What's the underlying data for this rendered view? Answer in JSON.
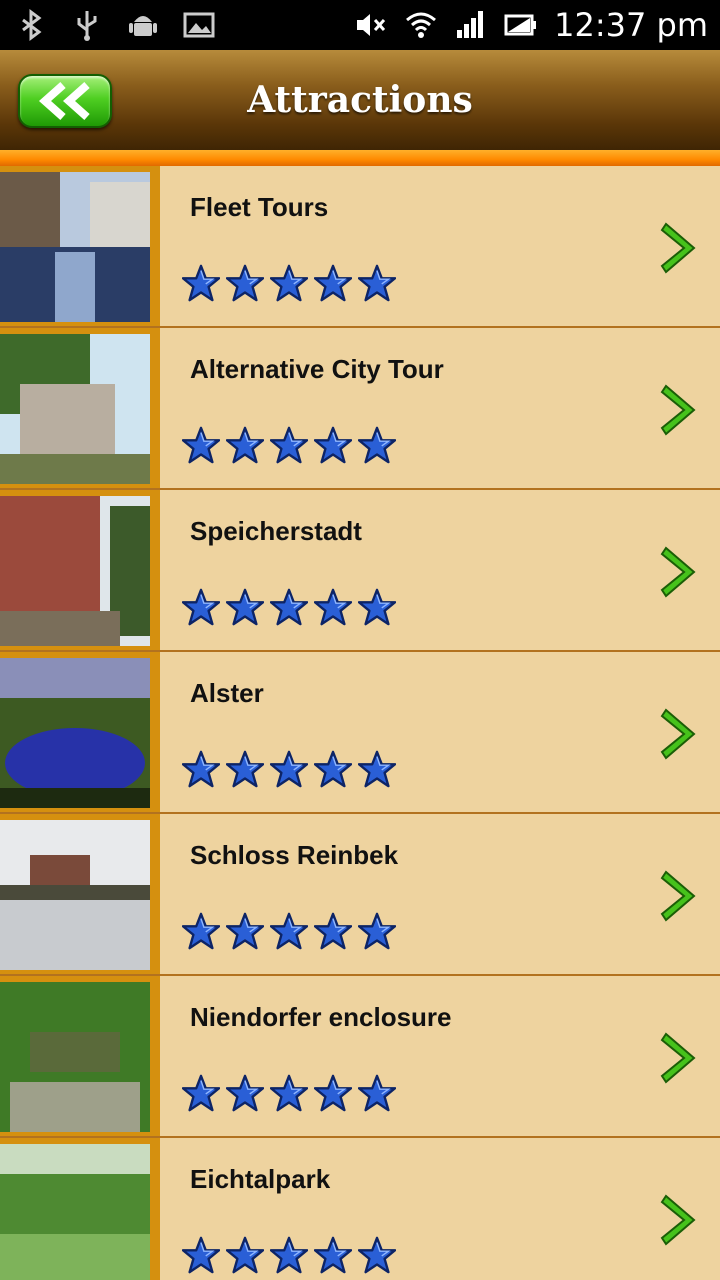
{
  "status_bar": {
    "time": "12:37 pm",
    "left_icons": [
      "bluetooth-icon",
      "usb-icon",
      "android-icon",
      "image-icon"
    ],
    "right_icons": [
      "mute-icon",
      "wifi-icon",
      "signal-icon",
      "battery-icon"
    ]
  },
  "header": {
    "title": "Attractions",
    "back_icon": "double-chevron-left-icon"
  },
  "attractions": [
    {
      "name": "Fleet Tours",
      "rating": 5
    },
    {
      "name": "Alternative City Tour",
      "rating": 5
    },
    {
      "name": "Speicherstadt",
      "rating": 5
    },
    {
      "name": "Alster",
      "rating": 5
    },
    {
      "name": "Schloss Reinbek",
      "rating": 5
    },
    {
      "name": "Niendorfer enclosure",
      "rating": 5
    },
    {
      "name": "Eichtalpark",
      "rating": 5
    }
  ],
  "colors": {
    "header_top": "#b78b3b",
    "header_bottom": "#3f2504",
    "accent_orange": "#ff8a00",
    "row_bg": "#eed39f",
    "star_blue": "#2a5fd6",
    "chevron_green": "#3fb71a"
  }
}
